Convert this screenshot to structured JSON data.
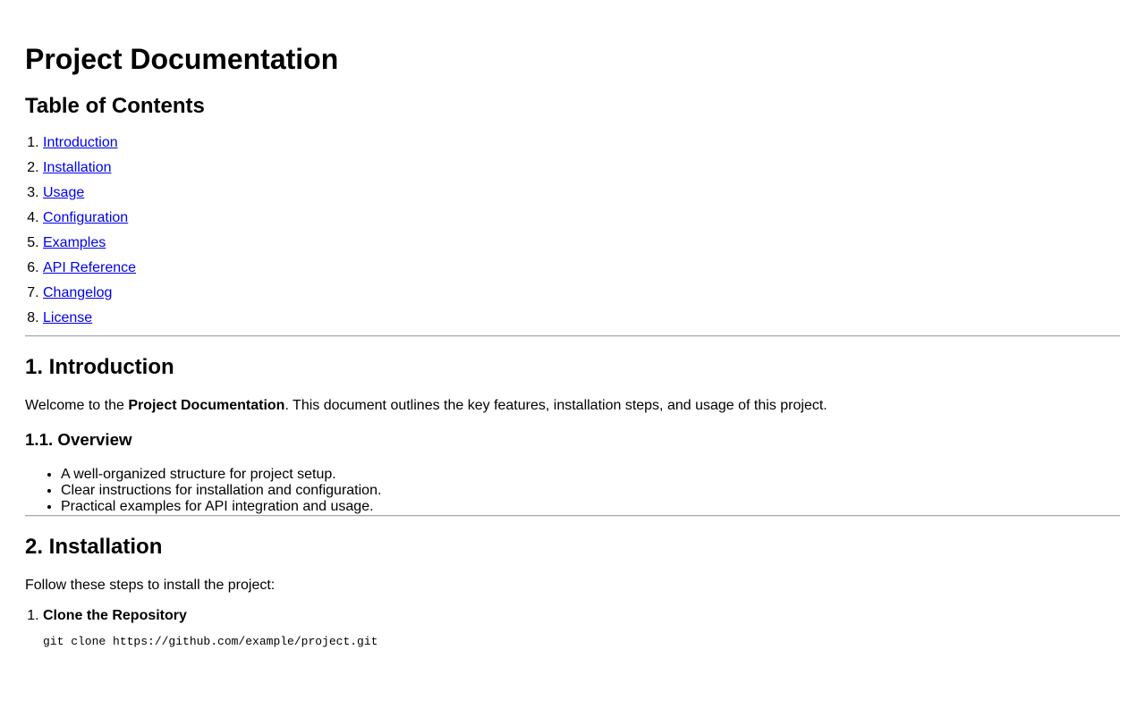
{
  "doc": {
    "title": "Project Documentation"
  },
  "toc": {
    "heading": "Table of Contents",
    "items": [
      {
        "label": "Introduction"
      },
      {
        "label": "Installation"
      },
      {
        "label": "Usage"
      },
      {
        "label": "Configuration"
      },
      {
        "label": "Examples"
      },
      {
        "label": "API Reference"
      },
      {
        "label": "Changelog"
      },
      {
        "label": "License"
      }
    ]
  },
  "introduction": {
    "heading": "1. Introduction",
    "text_before": "Welcome to the ",
    "text_bold": "Project Documentation",
    "text_after": ". This document outlines the key features, installation steps, and usage of this project.",
    "overview": {
      "heading": "1.1. Overview",
      "items": [
        "A well-organized structure for project setup.",
        "Clear instructions for installation and configuration.",
        "Practical examples for API integration and usage."
      ]
    }
  },
  "installation": {
    "heading": "2. Installation",
    "text": "Follow these steps to install the project:",
    "steps": [
      {
        "title": "Clone the Repository",
        "code": "git clone https://github.com/example/project.git"
      }
    ]
  }
}
